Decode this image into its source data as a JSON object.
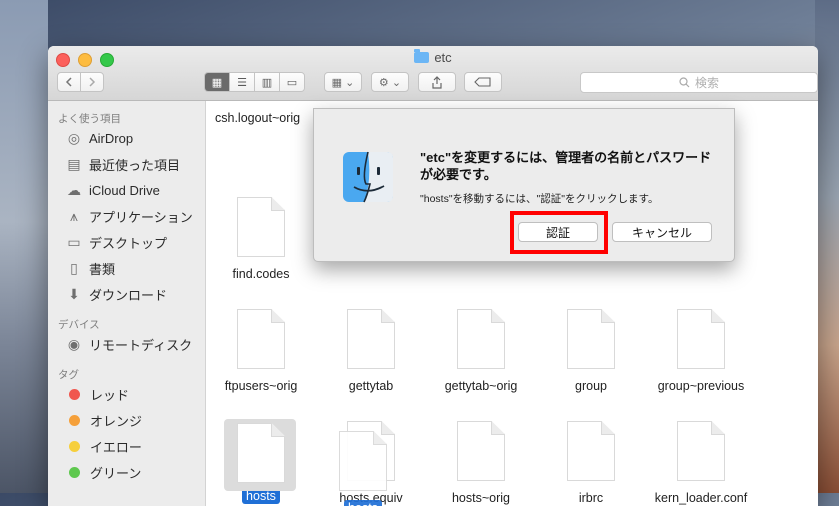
{
  "window": {
    "title": "etc"
  },
  "toolbar": {
    "search_placeholder": "検索",
    "view_modes": [
      "icon-view",
      "list-view",
      "column-view",
      "coverflow-view"
    ]
  },
  "sidebar": {
    "favorites_header": "よく使う項目",
    "favorites": [
      {
        "label": "AirDrop",
        "icon": "airdrop-icon"
      },
      {
        "label": "最近使った項目",
        "icon": "recents-icon"
      },
      {
        "label": "iCloud Drive",
        "icon": "cloud-icon"
      },
      {
        "label": "アプリケーション",
        "icon": "applications-icon"
      },
      {
        "label": "デスクトップ",
        "icon": "desktop-icon"
      },
      {
        "label": "書類",
        "icon": "documents-icon"
      },
      {
        "label": "ダウンロード",
        "icon": "downloads-icon"
      }
    ],
    "devices_header": "デバイス",
    "devices": [
      {
        "label": "リモートディスク",
        "icon": "disc-icon"
      }
    ],
    "tags_header": "タグ",
    "tags": [
      {
        "label": "レッド",
        "color": "#f0574f"
      },
      {
        "label": "オレンジ",
        "color": "#f5a03a"
      },
      {
        "label": "イエロー",
        "color": "#f6cf3c"
      },
      {
        "label": "グリーン",
        "color": "#5ec84e"
      }
    ]
  },
  "content": {
    "partial_file": "csh.logout~orig",
    "row1": [
      "find.codes"
    ],
    "row2": [
      "ftpusers~orig",
      "gettytab",
      "gettytab~orig",
      "group",
      "group~previous"
    ],
    "row3": [
      "hosts",
      "hosts.equiv",
      "hosts~orig",
      "irbrc",
      "kern_loader.conf"
    ],
    "drag_label": "hosts"
  },
  "dialog": {
    "title": "\"etc\"を変更するには、管理者の名前とパスワードが必要です。",
    "message": "\"hosts\"を移動するには、\"認証\"をクリックします。",
    "authenticate_label": "認証",
    "cancel_label": "キャンセル"
  }
}
